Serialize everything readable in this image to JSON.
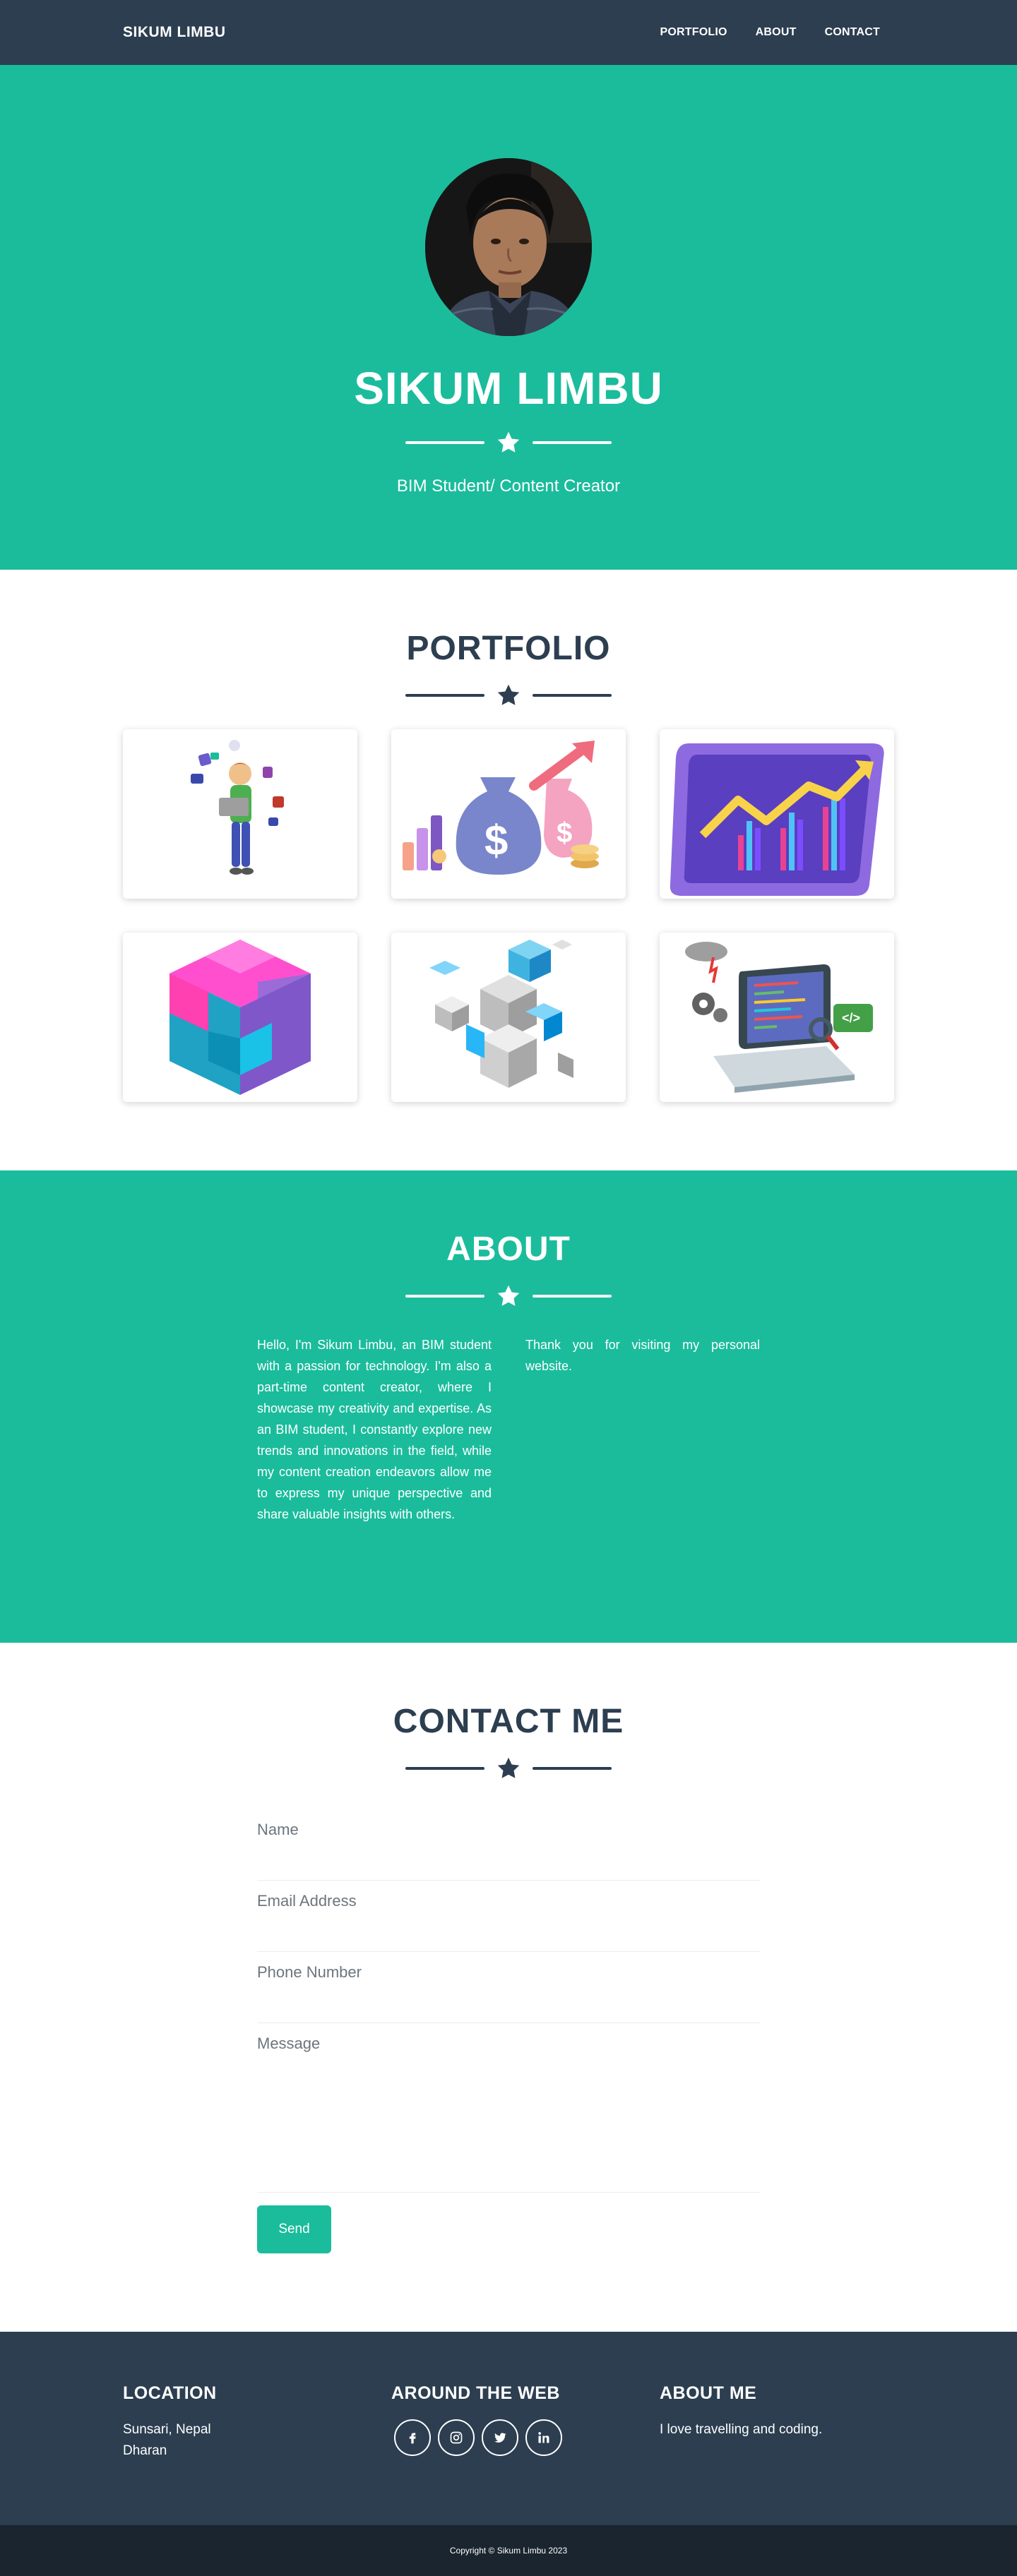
{
  "navbar": {
    "brand": "SIKUM LIMBU",
    "links": [
      "PORTFOLIO",
      "ABOUT",
      "CONTACT"
    ]
  },
  "hero": {
    "name": "SIKUM LIMBU",
    "subtitle": "BIM Student/ Content Creator"
  },
  "portfolio": {
    "title": "PORTFOLIO",
    "items": [
      {
        "icon": "person-with-laptop-illustration"
      },
      {
        "icon": "money-bags-growth-illustration"
      },
      {
        "icon": "growth-chart-tablet-illustration"
      },
      {
        "icon": "puzzle-cube-illustration"
      },
      {
        "icon": "cube-blocks-illustration"
      },
      {
        "icon": "laptop-code-illustration"
      }
    ]
  },
  "about": {
    "title": "ABOUT",
    "paragraph_left": "Hello, I'm Sikum Limbu, an BIM student with a passion for technology. I'm also a part-time content creator, where I showcase my creativity and expertise. As an BIM student, I constantly explore new trends and innovations in the field, while my content creation endeavors allow me to express my unique perspective and share valuable insights with others.",
    "paragraph_right": "Thank you for visiting my personal website."
  },
  "contact": {
    "title": "CONTACT ME",
    "name_placeholder": "Name",
    "email_placeholder": "Email Address",
    "phone_placeholder": "Phone Number",
    "message_placeholder": "Message",
    "send_label": "Send"
  },
  "footer": {
    "location_title": "LOCATION",
    "location_line1": "Sunsari, Nepal",
    "location_line2": "Dharan",
    "web_title": "AROUND THE WEB",
    "socials": [
      "facebook-icon",
      "instagram-icon",
      "twitter-icon",
      "linkedin-icon"
    ],
    "about_title": "ABOUT ME",
    "about_text": "I love travelling and coding."
  },
  "copyright": "Copyright © Sikum Limbu 2023",
  "colors": {
    "primary": "#2c3e50",
    "accent": "#1abc9c",
    "dark": "#1a252f"
  }
}
